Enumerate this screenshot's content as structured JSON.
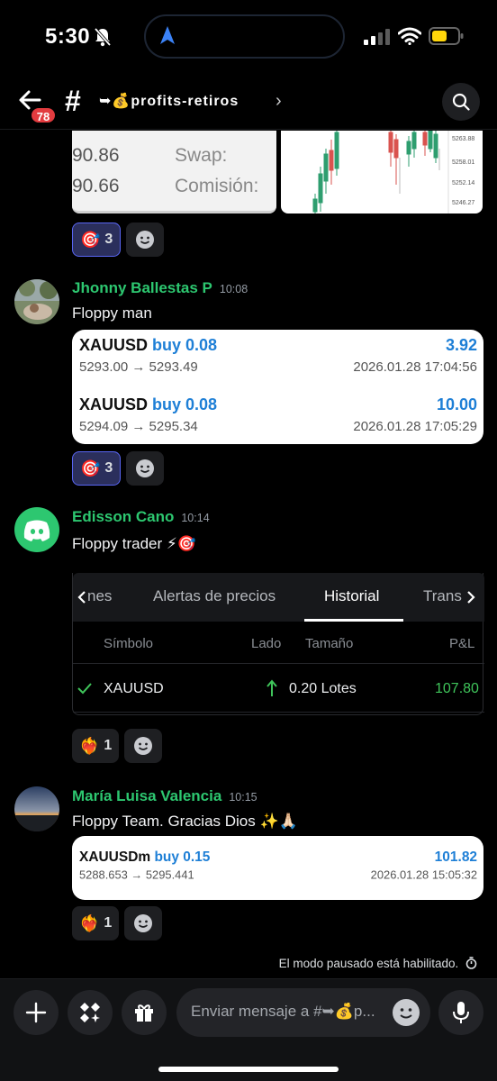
{
  "status_bar": {
    "time": "5:30"
  },
  "header": {
    "badge": "78",
    "hash": "#",
    "channel_name": "➥💰profits-retiros",
    "chevron": "›"
  },
  "attachment_top": {
    "rows": [
      {
        "value": "90.86",
        "key": "Swap:"
      },
      {
        "value": "90.66",
        "key": "Comisión:"
      }
    ],
    "chart_ticks": [
      "5263.88",
      "5258.01",
      "5252.14",
      "5246.27"
    ]
  },
  "reactions": {
    "r1": {
      "emoji": "🎯",
      "count": "3"
    },
    "r2": {
      "emoji": "🎯",
      "count": "3"
    },
    "r3": {
      "emoji": "❤️‍🔥",
      "count": "1"
    },
    "r4": {
      "emoji": "❤️‍🔥",
      "count": "1"
    }
  },
  "messages": [
    {
      "author": "Jhonny Ballestas P",
      "timestamp": "10:08",
      "text": "Floppy man",
      "trades": [
        {
          "symbol": "XAUUSD",
          "side": "buy 0.08",
          "pnl": "3.92",
          "prices": "5293.00 → 5293.49",
          "datetime": "2026.01.28 17:04:56"
        },
        {
          "symbol": "XAUUSD",
          "side": "buy 0.08",
          "pnl": "10.00",
          "prices": "5294.09 → 5295.34",
          "datetime": "2026.01.28 17:05:29"
        }
      ]
    },
    {
      "author": "Edisson Cano",
      "timestamp": "10:14",
      "text": "Floppy trader ⚡🎯",
      "history": {
        "tabs": [
          "nes",
          "Alertas de precios",
          "Historial",
          "Trans"
        ],
        "columns": [
          "Símbolo",
          "Lado",
          "Tamaño",
          "P&L"
        ],
        "row": {
          "symbol": "XAUUSD",
          "size": "0.20 Lotes",
          "pnl": "107.80"
        }
      }
    },
    {
      "author": "María Luisa Valencia",
      "timestamp": "10:15",
      "text": "Floppy Team. Gracias Dios ✨🙏🏻",
      "trades": [
        {
          "symbol": "XAUUSDm",
          "side": "buy 0.15",
          "pnl": "101.82",
          "prices": "5288.653 → 5295.441",
          "datetime": "2026.01.28 15:05:32"
        }
      ]
    }
  ],
  "footer": {
    "paused_notice": "El modo pausado está habilitado.",
    "input_placeholder": "Enviar mensaje a #➥💰p..."
  },
  "colors": {
    "author_green": "#2dc770",
    "accent_blue": "#1e7fd6",
    "pnl_green": "#3fc45a",
    "blurple": "#5865f2"
  }
}
